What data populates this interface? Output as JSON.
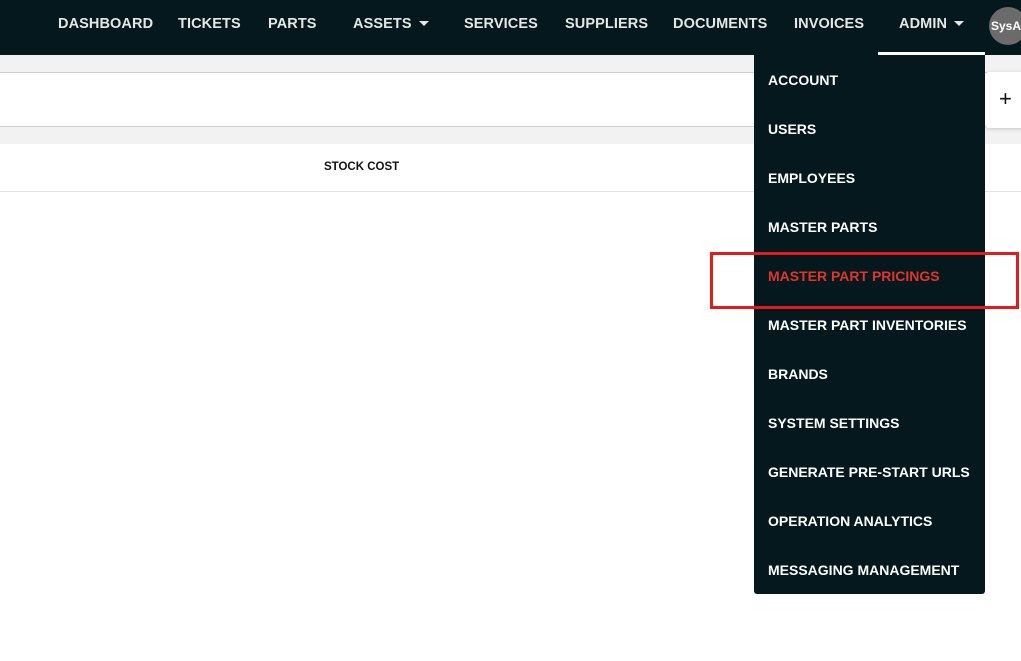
{
  "nav": {
    "dashboard": "DASHBOARD",
    "tickets": "TICKETS",
    "parts": "PARTS",
    "assets": "ASSETS",
    "services": "SERVICES",
    "suppliers": "SUPPLIERS",
    "documents": "DOCUMENTS",
    "invoices": "INVOICES",
    "admin": "ADMIN",
    "avatar_text": "SysA"
  },
  "table": {
    "column_stock_cost": "STOCK COST"
  },
  "add_button": "+",
  "admin_menu": {
    "items": [
      "ACCOUNT",
      "USERS",
      "EMPLOYEES",
      "MASTER PARTS",
      "MASTER PART PRICINGS",
      "MASTER PART INVENTORIES",
      "BRANDS",
      "SYSTEM SETTINGS",
      "GENERATE PRE-START URLS",
      "OPERATION ANALYTICS",
      "MESSAGING MANAGEMENT"
    ],
    "highlighted": "MASTER PART PRICINGS"
  },
  "colors": {
    "topbar_bg": "#04181d",
    "menu_active_text": "#e0352b",
    "highlight_box": "#e01c1c"
  }
}
